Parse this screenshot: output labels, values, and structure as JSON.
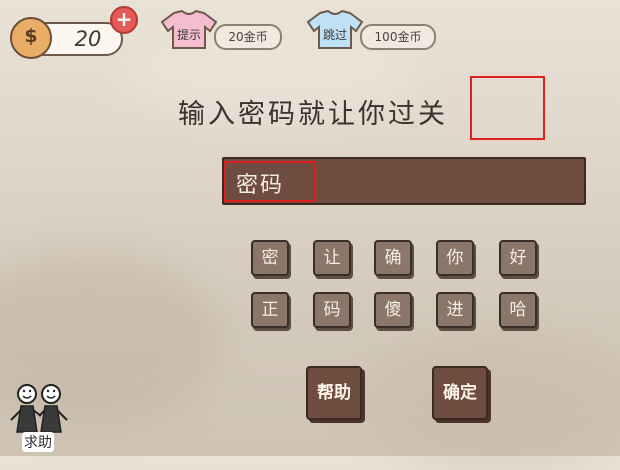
{
  "hud": {
    "coins": "20",
    "plus_label": "+",
    "hint": {
      "label": "提示",
      "cost": "20金币"
    },
    "skip": {
      "label": "跳过",
      "cost": "100金币"
    }
  },
  "title": "输入密码就让你过关",
  "password": {
    "value": "密码"
  },
  "tiles_row1": [
    "密",
    "让",
    "确",
    "你",
    "好"
  ],
  "tiles_row2": [
    "正",
    "码",
    "傻",
    "进",
    "哈"
  ],
  "buttons": {
    "help": "帮助",
    "confirm": "确定"
  },
  "ask_help": "求助",
  "colors": {
    "highlight": "#e02020",
    "tile": "#8b7769",
    "bar": "#6f4c40"
  }
}
